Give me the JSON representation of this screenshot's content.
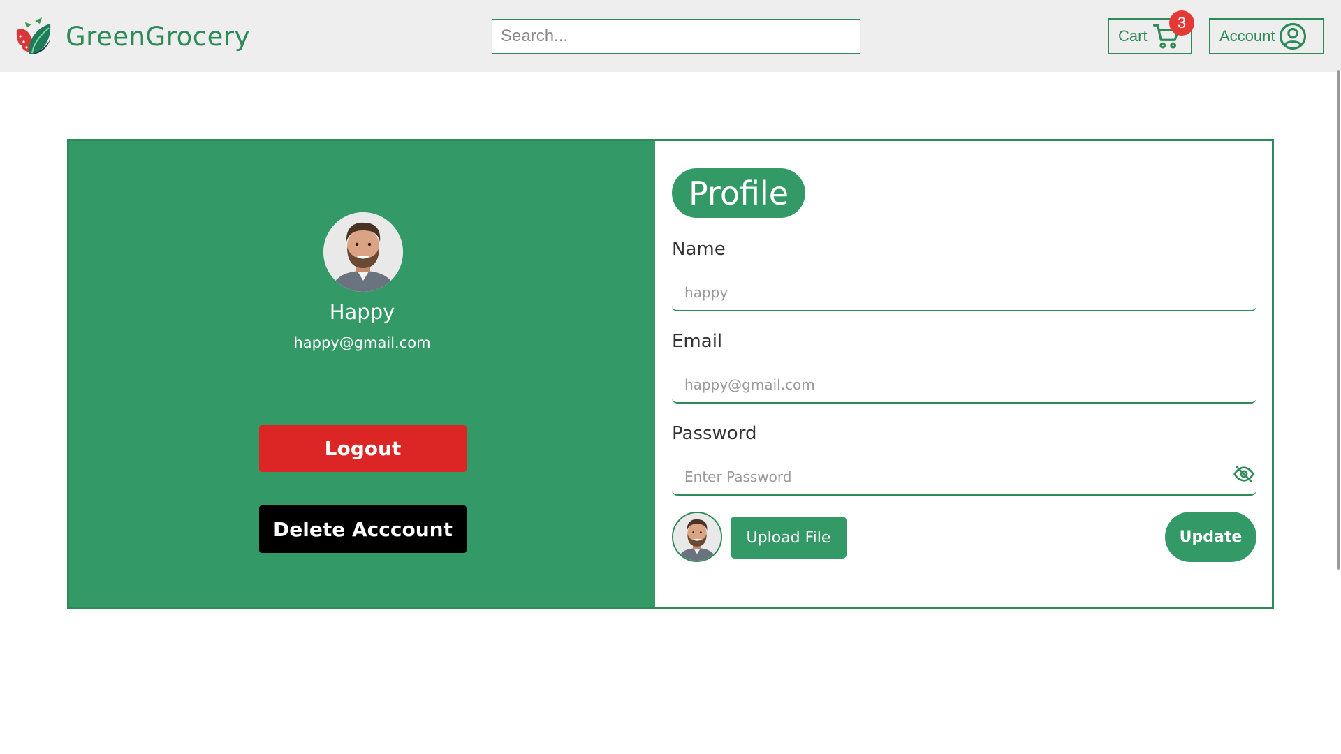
{
  "brand": {
    "name": "GreenGrocery",
    "logo_icon": "strawberry-leaf-logo-icon"
  },
  "search": {
    "placeholder": "Search..."
  },
  "cart": {
    "label": "Cart",
    "count": "3",
    "icon": "shopping-cart-icon"
  },
  "account": {
    "label": "Account",
    "icon": "user-circle-icon"
  },
  "user": {
    "name": "Happy",
    "email": "happy@gmail.com"
  },
  "actions": {
    "logout_label": "Logout",
    "delete_label": "Delete Acccount"
  },
  "profile": {
    "title": "Profile",
    "name_label": "Name",
    "name_placeholder": "happy",
    "email_label": "Email",
    "email_placeholder": "happy@gmail.com",
    "password_label": "Password",
    "password_placeholder": "Enter Password",
    "password_toggle_icon": "eye-off-icon",
    "upload_label": "Upload File",
    "update_label": "Update"
  },
  "colors": {
    "brand_green": "#339966",
    "accent_green": "#2e8b57",
    "danger": "#dc2626",
    "badge": "#e53935",
    "header_bg": "#eeeeee"
  }
}
